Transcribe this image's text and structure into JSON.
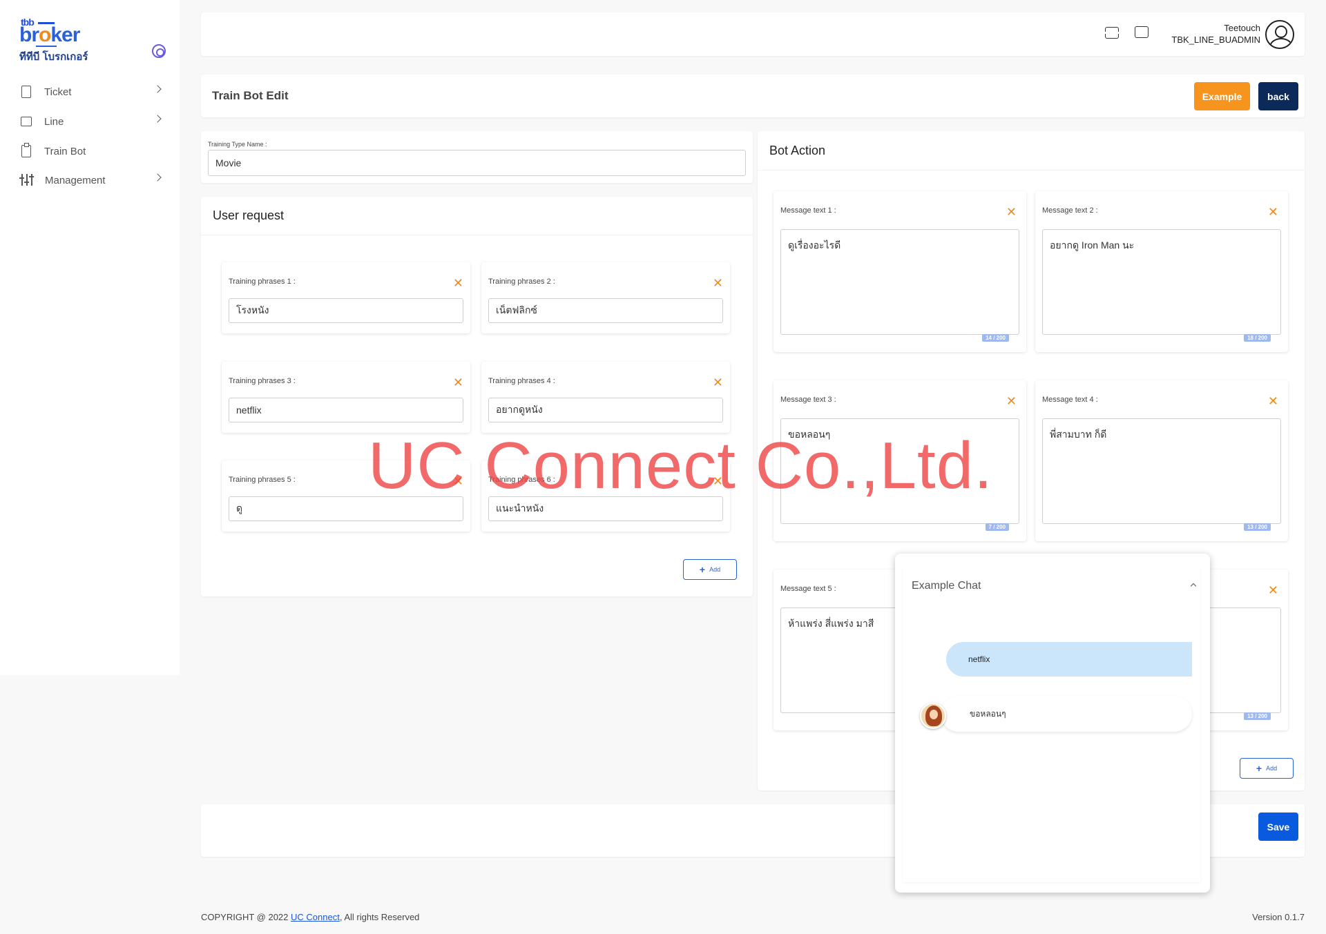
{
  "brand": {
    "top": "tbb",
    "main_a": "br",
    "main_o": "o",
    "main_b": "ker",
    "thai": "ทีทีบี โบรกเกอร์"
  },
  "sidebar": {
    "items": [
      {
        "label": "Ticket",
        "icon": "file-icon"
      },
      {
        "label": "Line",
        "icon": "chat-icon"
      },
      {
        "label": "Train Bot",
        "icon": "clipboard-icon"
      },
      {
        "label": "Management",
        "icon": "sliders-icon"
      }
    ]
  },
  "header": {
    "user_name": "Teetouch",
    "user_role": "TBK_LINE_BUADMIN"
  },
  "page": {
    "title": "Train Bot Edit",
    "example_label": "Example",
    "back_label": "back"
  },
  "training_type": {
    "label": "Training Type Name :",
    "value": "Movie"
  },
  "user_request": {
    "title": "User request",
    "phrases": [
      {
        "label": "Training phrases 1 :",
        "value": "โรงหนัง"
      },
      {
        "label": "Training phrases 2 :",
        "value": "เน็ตฟลิกซ์"
      },
      {
        "label": "Training phrases 3 :",
        "value": "netflix"
      },
      {
        "label": "Training phrases 4 :",
        "value": "อยากดูหนัง"
      },
      {
        "label": "Training phrases 5 :",
        "value": "ดู"
      },
      {
        "label": "Training phrases 6 :",
        "value": "แนะนำหนัง"
      }
    ],
    "add_label": "Add"
  },
  "bot_action": {
    "title": "Bot Action",
    "messages": [
      {
        "label": "Message text 1 :",
        "value": "ดูเรื่องอะไรดี",
        "count": "14 / 200"
      },
      {
        "label": "Message text 2 :",
        "value": "อยากดู Iron Man นะ",
        "count": "18 / 200"
      },
      {
        "label": "Message text 3 :",
        "value": "ขอหลอนๆ",
        "count": "7 / 200"
      },
      {
        "label": "Message text 4 :",
        "value": "พี่สามบาท ก็ดี",
        "count": "13 / 200"
      },
      {
        "label": "Message text 5 :",
        "value": "ห้าแพร่ง สี่แพร่ง มาสี",
        "count": ""
      },
      {
        "label": "",
        "value": "",
        "count": "13 / 200"
      }
    ],
    "add_label": "Add"
  },
  "save_label": "Save",
  "example_chat": {
    "title": "Example Chat",
    "user_msg": "netflix",
    "bot_msg": "ขอหลอนๆ"
  },
  "watermark": "UC Connect Co.,Ltd.",
  "footer": {
    "copyright": "COPYRIGHT @ 2022 ",
    "link": "UC Connect",
    "rights": ", All rights Reserved",
    "version": "Version 0.1.7"
  }
}
